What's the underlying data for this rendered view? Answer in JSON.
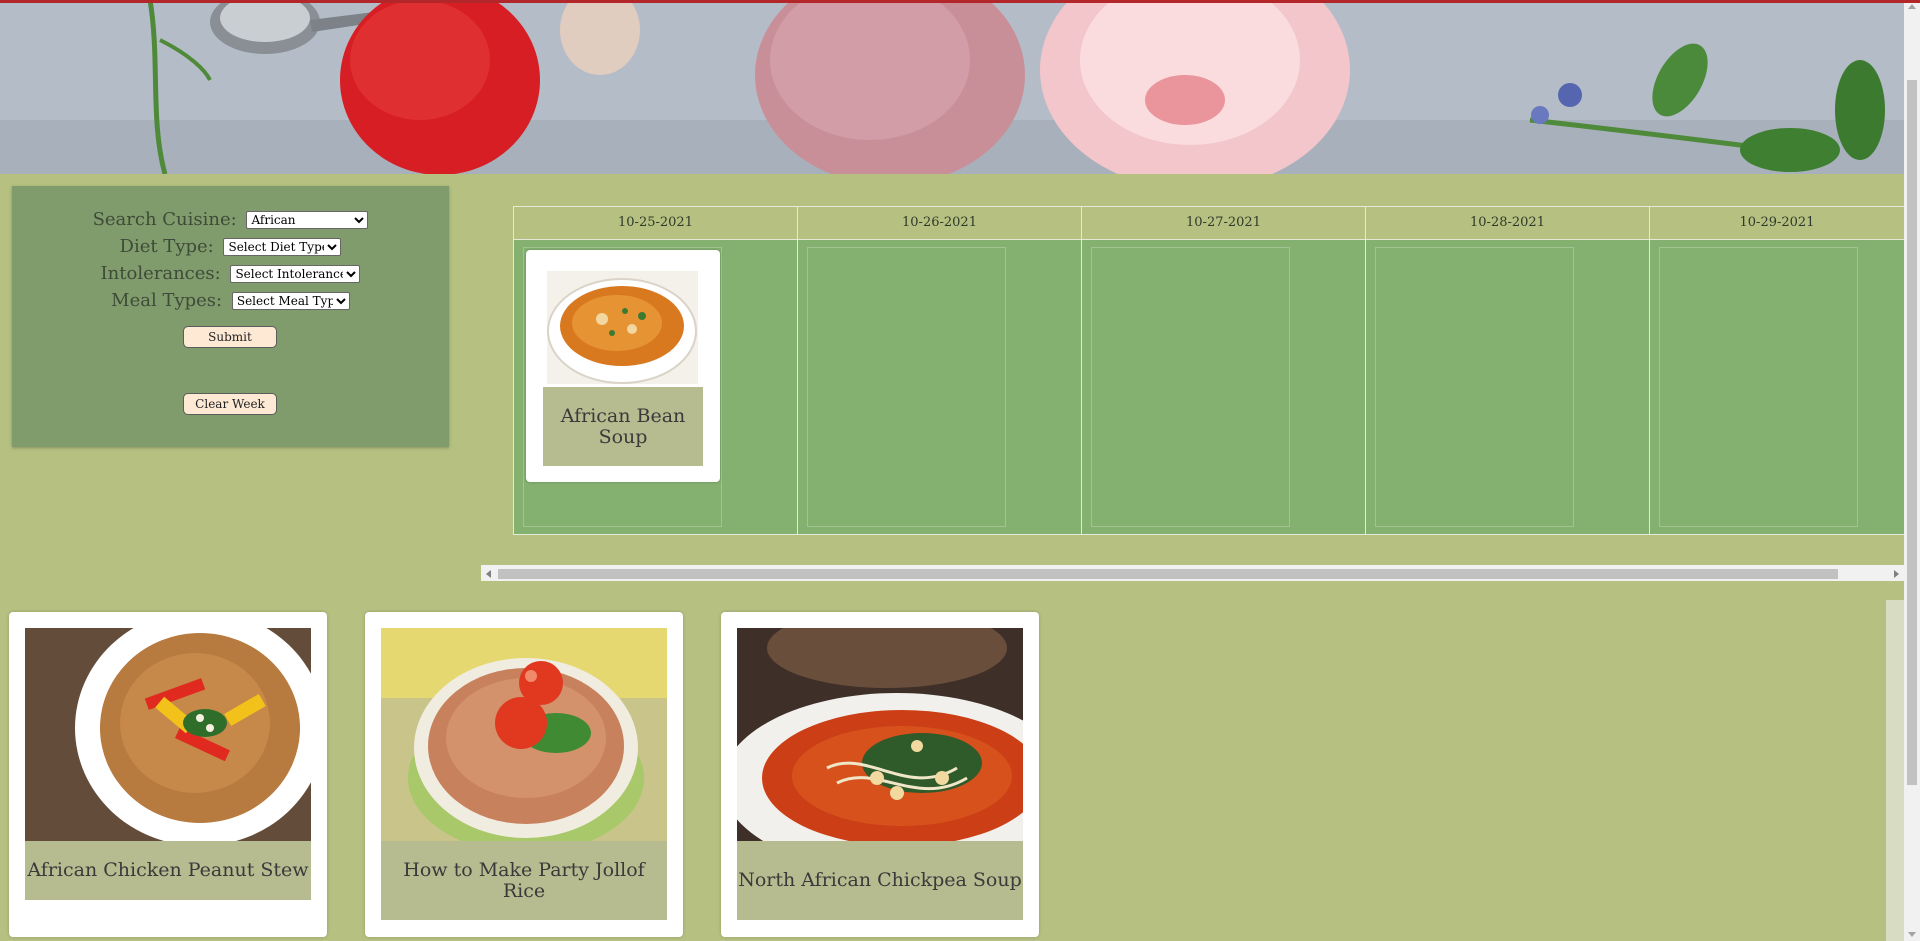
{
  "colors": {
    "page_bg": "#b5c081",
    "panel_bg": "#809c6c",
    "week_bg": "#84b070",
    "card_title_bg": "#b6bc90",
    "button_bg": "#fde9d4",
    "accent_top": "#b3262a"
  },
  "hero": {
    "image": "strawberries-and-ice-cream-banner"
  },
  "search": {
    "cuisine_label": "Search Cuisine:",
    "cuisine_value": "African",
    "diet_label": "Diet Type:",
    "diet_value": "Select Diet Type",
    "intolerances_label": "Intolerances:",
    "intolerances_value": "Select Intolerances",
    "meal_label": "Meal Types:",
    "meal_value": "Select Meal Type",
    "submit_label": "Submit",
    "clear_label": "Clear Week"
  },
  "week": {
    "days": [
      "10-25-2021",
      "10-26-2021",
      "10-27-2021",
      "10-28-2021",
      "10-29-2021"
    ],
    "planned": {
      "day": "10-25-2021",
      "title": "African Bean Soup",
      "image": "bean-soup-bowl"
    }
  },
  "results": [
    {
      "title": "African Chicken Peanut Stew",
      "image": "peanut-stew-bowl"
    },
    {
      "title": "How to Make Party Jollof Rice",
      "image": "jollof-rice-bowl"
    },
    {
      "title": "North African Chickpea Soup",
      "image": "chickpea-soup-plate"
    }
  ]
}
